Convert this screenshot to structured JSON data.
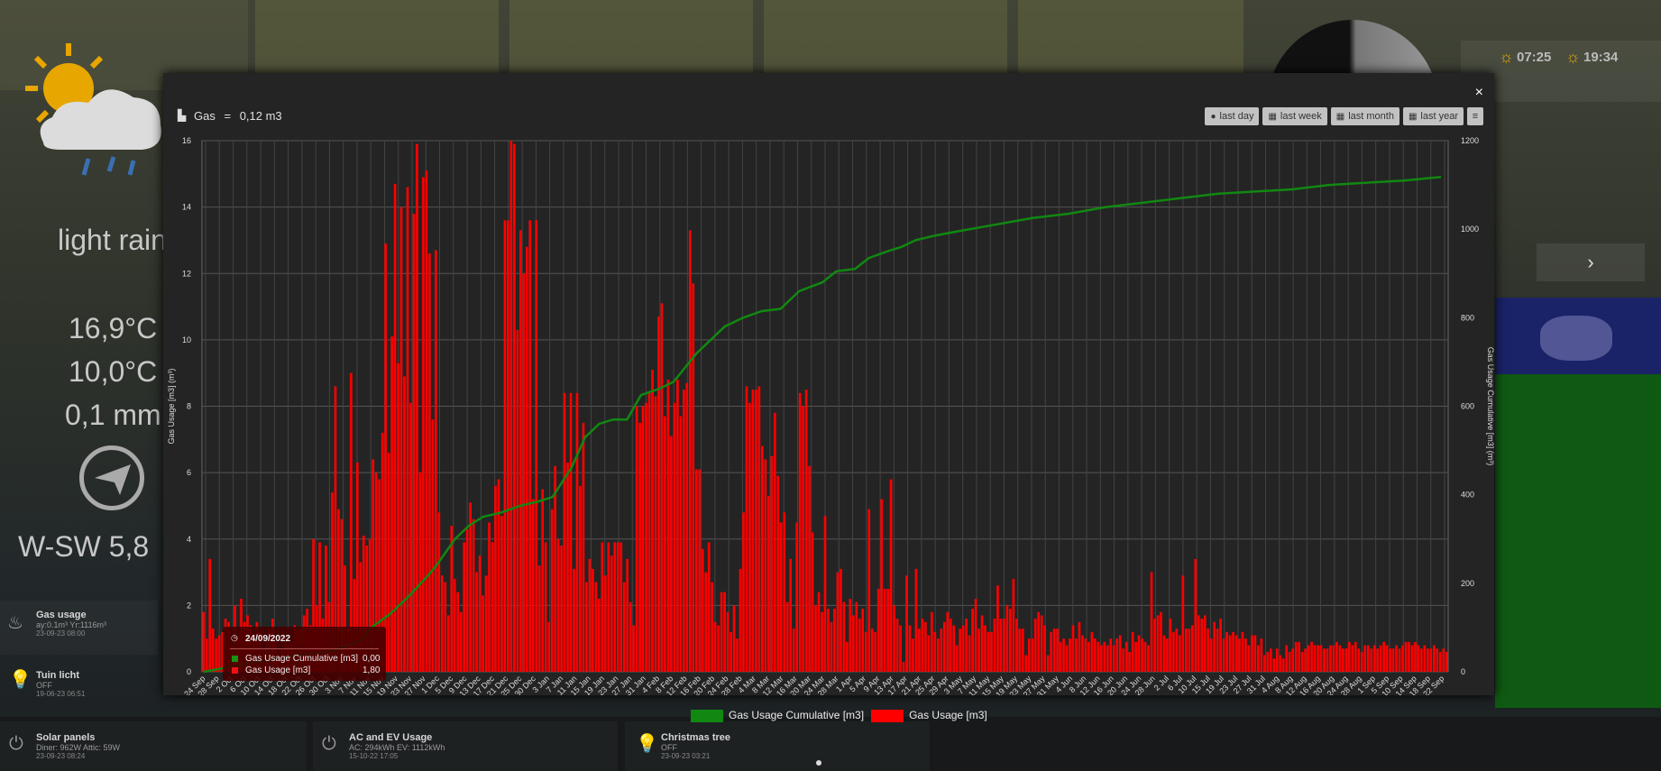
{
  "background": {
    "weather": {
      "condition": "light rain",
      "temp_high": "16,9°C",
      "temp_low": "10,0°C",
      "rain": "0,1 mm",
      "wind": "W-SW 5,8"
    },
    "sun": {
      "sunrise": "07:25",
      "sunset": "19:34"
    },
    "devices": [
      {
        "name": "Gas usage",
        "sub": "ay:0.1m³ Yr:1116m³",
        "time": "23-09-23 08:00"
      },
      {
        "name": "Tuin licht",
        "sub": "OFF",
        "time": "19-06-23 06:51"
      },
      {
        "name": "Solar panels",
        "sub": "Diner: 962W Attic: 59W",
        "time": "23-09-23 08:24"
      },
      {
        "name": "AC and EV Usage",
        "sub": "AC: 294kWh EV: 1112kWh",
        "time": "15-10-22 17:05"
      },
      {
        "name": "Christmas tree",
        "sub": "OFF",
        "time": "23-09-23 03:21"
      }
    ]
  },
  "modal": {
    "title": "Gas",
    "title_value": "0,12 m3",
    "close_label": "×",
    "buttons": [
      {
        "label": "last day",
        "icon": "clock-icon"
      },
      {
        "label": "last week",
        "icon": "calendar-icon"
      },
      {
        "label": "last month",
        "icon": "calendar-icon"
      },
      {
        "label": "last year",
        "icon": "calendar-icon"
      }
    ],
    "menu_icon": "menu-icon"
  },
  "tooltip": {
    "date": "24/09/2022",
    "rows": [
      {
        "label": "Gas Usage Cumulative [m3]",
        "value": "0,00",
        "color": "#139413"
      },
      {
        "label": "Gas Usage [m3]",
        "value": "1,80",
        "color": "#e11"
      }
    ]
  },
  "chart_data": {
    "type": "bar",
    "title": "",
    "ylabel_left": "Gas Usage [m3] (m³)",
    "ylabel_right": "Gas Usage Cumulative [m3] (m³)",
    "ylim_left": [
      0,
      16
    ],
    "ylim_right": [
      0,
      1200
    ],
    "yticks_left": [
      "0",
      "2",
      "4",
      "6",
      "8",
      "10",
      "12",
      "14",
      "16"
    ],
    "yticks_right": [
      "0",
      "200",
      "400",
      "600",
      "800",
      "1000",
      "1200"
    ],
    "grid": true,
    "legend_position": "bottom",
    "x_ticks": [
      "24 Sep",
      "28 Sep",
      "2 Oct",
      "6 Oct",
      "10 Oct",
      "14 Oct",
      "18 Oct",
      "22 Oct",
      "26 Oct",
      "30 Oct",
      "3 Nov",
      "7 Nov",
      "11 Nov",
      "15 Nov",
      "19 Nov",
      "23 Nov",
      "27 Nov",
      "1 Dec",
      "5 Dec",
      "9 Dec",
      "13 Dec",
      "17 Dec",
      "21 Dec",
      "25 Dec",
      "30 Dec",
      "3 Jan",
      "7 Jan",
      "11 Jan",
      "15 Jan",
      "19 Jan",
      "23 Jan",
      "27 Jan",
      "31 Jan",
      "4 Feb",
      "8 Feb",
      "12 Feb",
      "16 Feb",
      "20 Feb",
      "24 Feb",
      "28 Feb",
      "4 Mar",
      "8 Mar",
      "12 Mar",
      "16 Mar",
      "20 Mar",
      "24 Mar",
      "28 Mar",
      "1 Apr",
      "5 Apr",
      "9 Apr",
      "13 Apr",
      "17 Apr",
      "21 Apr",
      "25 Apr",
      "29 Apr",
      "3 May",
      "7 May",
      "11 May",
      "15 May",
      "19 May",
      "23 May",
      "27 May",
      "31 May",
      "4 Jun",
      "8 Jun",
      "12 Jun",
      "16 Jun",
      "20 Jun",
      "24 Jun",
      "28 Jun",
      "2 Jul",
      "6 Jul",
      "10 Jul",
      "15 Jul",
      "19 Jul",
      "23 Jul",
      "27 Jul",
      "31 Jul",
      "4 Aug",
      "8 Aug",
      "12 Aug",
      "16 Aug",
      "20 Aug",
      "24 Aug",
      "28 Aug",
      "1 Sep",
      "5 Sep",
      "10 Sep",
      "14 Sep",
      "18 Sep",
      "22 Sep"
    ],
    "series": [
      {
        "name": "Gas Usage [m3]",
        "color": "#ff0000",
        "type": "bar",
        "values": [
          1.8,
          1.0,
          3.4,
          1.3,
          1.0,
          1.1,
          1.2,
          1.6,
          1.5,
          0.8,
          2.0,
          1.1,
          2.2,
          1.5,
          1.7,
          1.4,
          1.1,
          1.5,
          1.2,
          0.7,
          0.9,
          1.3,
          1.6,
          1.1,
          0.5,
          0.7,
          1.1,
          0.8,
          0.9,
          1.4,
          1.3,
          1.3,
          1.7,
          1.9,
          1.4,
          4.0,
          2.0,
          3.9,
          1.6,
          3.8,
          2.1,
          5.4,
          8.6,
          4.9,
          4.6,
          3.2,
          1.3,
          9.0,
          2.8,
          6.3,
          3.3,
          4.1,
          3.8,
          4.0,
          6.4,
          6.0,
          5.8,
          7.2,
          12.9,
          6.6,
          10.1,
          14.7,
          9.3,
          14.0,
          8.9,
          14.6,
          8.1,
          13.8,
          15.9,
          6.0,
          14.9,
          15.1,
          12.6,
          7.6,
          12.7,
          4.8,
          2.9,
          2.7,
          1.7,
          4.4,
          2.8,
          2.4,
          1.8,
          3.9,
          4.3,
          5.1,
          4.6,
          3.0,
          3.5,
          2.3,
          2.9,
          4.5,
          3.9,
          5.6,
          5.8,
          4.7,
          13.6,
          13.6,
          16.0,
          15.9,
          10.3,
          13.3,
          12.0,
          12.8,
          13.6,
          5.2,
          13.6,
          3.2,
          5.5,
          3.9,
          1.5,
          4.9,
          6.2,
          4.0,
          3.8,
          8.4,
          6.3,
          8.4,
          3.1,
          8.4,
          5.6,
          7.5,
          2.7,
          3.4,
          3.1,
          2.7,
          2.2,
          3.9,
          2.9,
          3.9,
          3.5,
          3.9,
          3.9,
          3.9,
          2.7,
          3.4,
          2.1,
          1.4,
          8.0,
          7.5,
          8.0,
          8.1,
          8.4,
          9.1,
          8.3,
          10.7,
          11.1,
          7.7,
          8.8,
          7.1,
          8.1,
          8.8,
          7.7,
          8.5,
          8.7,
          13.3,
          11.7,
          6.1,
          6.1,
          3.7,
          3.0,
          3.9,
          2.7,
          1.5,
          1.4,
          2.4,
          2.4,
          1.8,
          1.2,
          2.0,
          1.0,
          3.1,
          4.8,
          8.6,
          8.1,
          8.5,
          8.5,
          8.6,
          6.8,
          6.4,
          5.3,
          6.5,
          7.8,
          5.9,
          4.5,
          4.8,
          2.1,
          3.4,
          1.3,
          4.5,
          8.4,
          8.0,
          8.5,
          6.2,
          4.2,
          2.0,
          2.4,
          1.8,
          4.7,
          1.9,
          1.5,
          1.9,
          3.0,
          3.1,
          2.1,
          0.9,
          2.2,
          1.7,
          2.1,
          1.6,
          1.9,
          1.2,
          4.9,
          1.3,
          1.2,
          2.5,
          5.2,
          2.5,
          2.5,
          5.8,
          2.0,
          1.6,
          1.4,
          0.3,
          2.9,
          1.4,
          1.0,
          3.1,
          1.3,
          1.6,
          1.5,
          1.1,
          1.8,
          1.2,
          1.0,
          1.3,
          1.5,
          1.8,
          1.6,
          1.4,
          0.8,
          1.3,
          1.4,
          1.6,
          1.1,
          1.9,
          2.2,
          1.3,
          1.7,
          1.4,
          1.2,
          1.2,
          1.6,
          2.6,
          1.6,
          1.6,
          2.0,
          1.9,
          2.8,
          1.6,
          1.3,
          1.3,
          0.5,
          1.0,
          1.0,
          1.6,
          1.8,
          1.7,
          1.4,
          0.5,
          1.2,
          1.3,
          1.3,
          0.9,
          1.0,
          0.8,
          1.0,
          1.4,
          1.0,
          1.5,
          1.1,
          1.0,
          0.9,
          1.2,
          1.0,
          0.9,
          0.8,
          0.9,
          0.8,
          1.0,
          0.8,
          1.0,
          1.1,
          0.7,
          0.9,
          0.6,
          1.2,
          0.9,
          1.1,
          1.0,
          0.9,
          0.8,
          3.0,
          1.6,
          1.7,
          1.8,
          1.1,
          1.0,
          1.6,
          1.2,
          1.3,
          1.1,
          2.9,
          1.3,
          1.3,
          1.4,
          3.4,
          1.7,
          1.6,
          1.7,
          1.3,
          1.0,
          1.5,
          1.3,
          1.6,
          1.0,
          1.2,
          1.1,
          1.2,
          1.1,
          1.0,
          1.2,
          1.0,
          0.8,
          1.1,
          1.1,
          0.8,
          1.0,
          0.5,
          0.6,
          0.7,
          0.4,
          0.7,
          0.5,
          0.4,
          0.8,
          0.6,
          0.7,
          0.9,
          0.9,
          0.6,
          0.7,
          0.8,
          0.9,
          0.8,
          0.8,
          0.8,
          0.7,
          0.7,
          0.8,
          0.8,
          0.9,
          0.8,
          0.7,
          0.7,
          0.9,
          0.8,
          0.9,
          0.7,
          0.6,
          0.8,
          0.8,
          0.7,
          0.8,
          0.7,
          0.8,
          0.9,
          0.8,
          0.7,
          0.7,
          0.8,
          0.7,
          0.8,
          0.9,
          0.9,
          0.8,
          0.9,
          0.8,
          0.7,
          0.8,
          0.7,
          0.7,
          0.8,
          0.7,
          0.6,
          0.7,
          0.6
        ]
      },
      {
        "name": "Gas Usage Cumulative [m3]",
        "color": "#118811",
        "type": "line",
        "points": [
          [
            0,
            0
          ],
          [
            20,
            20
          ],
          [
            40,
            37
          ],
          [
            56,
            47
          ],
          [
            60,
            57
          ],
          [
            68,
            72
          ],
          [
            72,
            100
          ],
          [
            80,
            130
          ],
          [
            88,
            170
          ],
          [
            96,
            215
          ],
          [
            100,
            240
          ],
          [
            108,
            300
          ],
          [
            114,
            330
          ],
          [
            120,
            350
          ],
          [
            128,
            360
          ],
          [
            136,
            375
          ],
          [
            144,
            385
          ],
          [
            150,
            395
          ],
          [
            158,
            460
          ],
          [
            164,
            530
          ],
          [
            170,
            560
          ],
          [
            176,
            570
          ],
          [
            182,
            570
          ],
          [
            188,
            625
          ],
          [
            196,
            640
          ],
          [
            202,
            655
          ],
          [
            212,
            720
          ],
          [
            218,
            750
          ],
          [
            224,
            780
          ],
          [
            232,
            800
          ],
          [
            240,
            815
          ],
          [
            248,
            820
          ],
          [
            256,
            860
          ],
          [
            266,
            880
          ],
          [
            272,
            905
          ],
          [
            280,
            910
          ],
          [
            286,
            935
          ],
          [
            294,
            950
          ],
          [
            300,
            960
          ],
          [
            306,
            975
          ],
          [
            314,
            985
          ],
          [
            324,
            995
          ],
          [
            340,
            1010
          ],
          [
            356,
            1025
          ],
          [
            372,
            1035
          ],
          [
            388,
            1050
          ],
          [
            404,
            1060
          ],
          [
            420,
            1070
          ],
          [
            436,
            1080
          ],
          [
            452,
            1085
          ],
          [
            468,
            1090
          ],
          [
            484,
            1100
          ],
          [
            500,
            1105
          ],
          [
            516,
            1110
          ],
          [
            532,
            1118
          ]
        ]
      }
    ]
  }
}
